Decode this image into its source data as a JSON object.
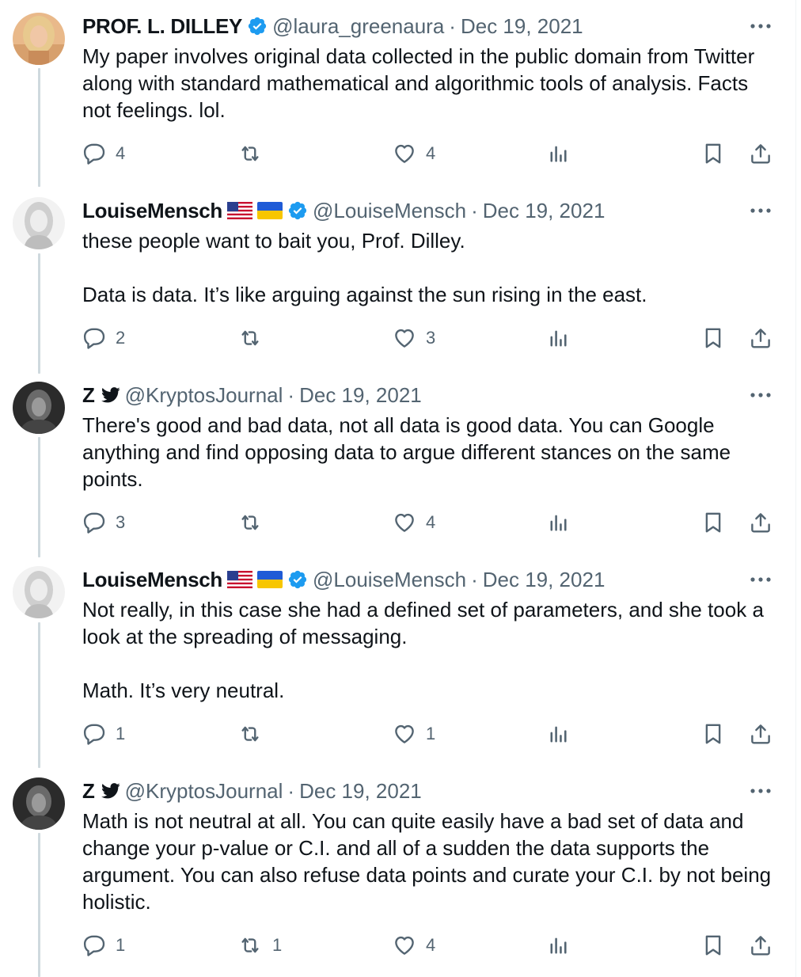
{
  "tweets": [
    {
      "name": "PROF. L. DILLEY",
      "handle": "@laura_greenaura",
      "separator": "·",
      "date": "Dec 19, 2021",
      "text": "My paper involves original data collected in the public domain from Twitter along with standard mathematical and algorithmic tools of analysis. Facts not feelings. lol.",
      "replies": "4",
      "reposts": "",
      "likes": "4"
    },
    {
      "name": "LouiseMensch",
      "handle": "@LouiseMensch",
      "separator": "·",
      "date": "Dec 19, 2021",
      "text": "these people want to bait you, Prof. Dilley.\n\nData is data. It’s like arguing against the sun rising in the east.",
      "replies": "2",
      "reposts": "",
      "likes": "3"
    },
    {
      "name": "Z",
      "handle": "@KryptosJournal",
      "separator": "·",
      "date": "Dec 19, 2021",
      "text": "There's good and bad data, not all data is good data. You can Google anything and find opposing data to argue different stances on the same points.",
      "replies": "3",
      "reposts": "",
      "likes": "4"
    },
    {
      "name": "LouiseMensch",
      "handle": "@LouiseMensch",
      "separator": "·",
      "date": "Dec 19, 2021",
      "text": "Not really, in this case she had a defined set of parameters, and she took a look at the spreading of messaging.\n\nMath. It’s very neutral.",
      "replies": "1",
      "reposts": "",
      "likes": "1"
    },
    {
      "name": "Z",
      "handle": "@KryptosJournal",
      "separator": "·",
      "date": "Dec 19, 2021",
      "text": "Math is not neutral at all. You can quite easily have a bad set of data and change your p-value or C.I. and all of a sudden the data supports the argument. You can also refuse data points and curate your C.I. by not being holistic.",
      "replies": "1",
      "reposts": "1",
      "likes": "4"
    }
  ],
  "colors": {
    "text": "#0f1419",
    "secondary": "#536471",
    "verified": "#1d9bf0",
    "thread_line": "#cfd9de"
  },
  "icons": {
    "reply": "speech-bubble-icon",
    "repost": "repost-arrows-icon",
    "like": "heart-icon",
    "views": "bar-chart-icon",
    "bookmark": "bookmark-icon",
    "share": "upload-share-icon",
    "more": "ellipsis-icon",
    "verified": "verified-badge-icon",
    "flag_us": "us-flag-icon",
    "flag_ua": "ukraine-flag-icon",
    "bird": "twitter-bird-icon"
  }
}
